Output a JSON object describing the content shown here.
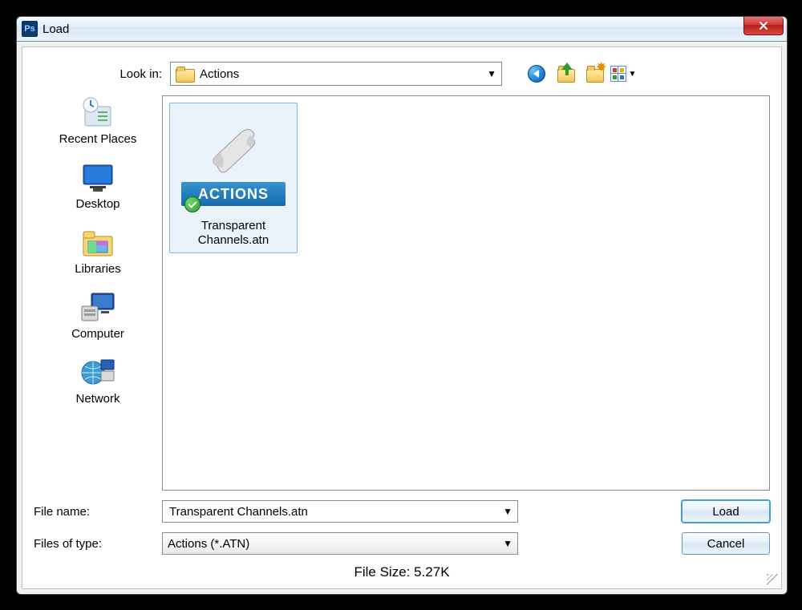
{
  "window": {
    "title": "Load"
  },
  "lookin": {
    "label": "Look in:",
    "value": "Actions"
  },
  "nav_icons": {
    "back": "back-icon",
    "up": "up-one-level-icon",
    "new": "new-folder-icon",
    "view": "view-menu-icon"
  },
  "places": [
    {
      "id": "recent",
      "label": "Recent Places",
      "icon": "recent-places-icon"
    },
    {
      "id": "desktop",
      "label": "Desktop",
      "icon": "desktop-icon"
    },
    {
      "id": "libraries",
      "label": "Libraries",
      "icon": "libraries-icon"
    },
    {
      "id": "computer",
      "label": "Computer",
      "icon": "computer-icon"
    },
    {
      "id": "network",
      "label": "Network",
      "icon": "network-icon"
    }
  ],
  "files": [
    {
      "name_line1": "Transparent",
      "name_line2": "Channels.atn",
      "badge": "ACTIONS"
    }
  ],
  "filename": {
    "label": "File name:",
    "value": "Transparent Channels.atn"
  },
  "filetype": {
    "label": "Files of type:",
    "value": "Actions (*.ATN)"
  },
  "buttons": {
    "load": "Load",
    "cancel": "Cancel"
  },
  "filesize": {
    "text": "File Size: 5.27K"
  }
}
